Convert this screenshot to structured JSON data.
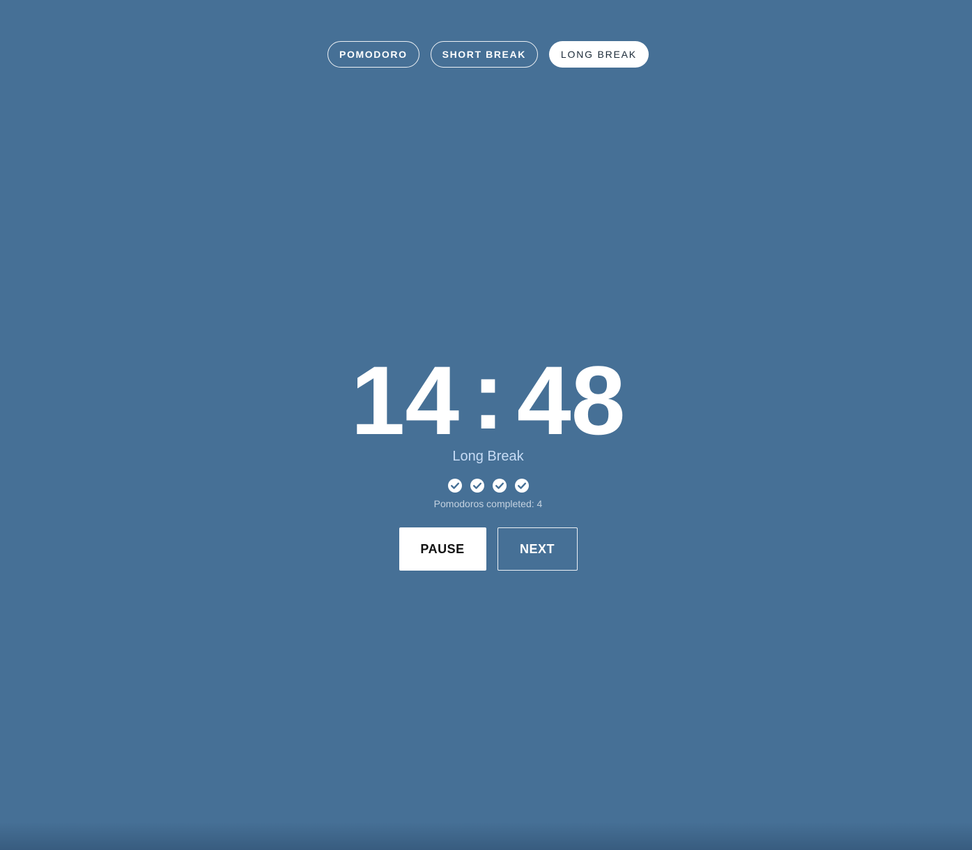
{
  "modes": [
    {
      "label": "POMODORO",
      "active": false
    },
    {
      "label": "SHORT BREAK",
      "active": false
    },
    {
      "label": "LONG BREAK",
      "active": true
    }
  ],
  "timer": {
    "minutes": "14",
    "separator": ":",
    "seconds": "48"
  },
  "mode_label": "Long Break",
  "progress": {
    "icon": "check-circle-icon",
    "completed_count": 4,
    "text": "Pomodoros completed: 4"
  },
  "controls": {
    "pause_label": "PAUSE",
    "next_label": "NEXT"
  },
  "colors": {
    "background": "#467096",
    "accent_text": "#c7dcf5",
    "foreground": "#ffffff"
  }
}
